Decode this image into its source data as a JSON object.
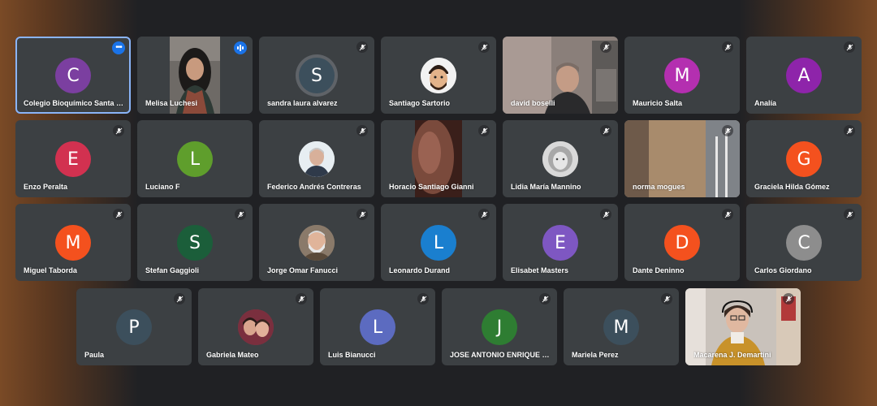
{
  "colors": {
    "tile_bg": "#3c4043",
    "active_outline": "#8ab4f8",
    "accent": "#1a73e8"
  },
  "icons": {
    "muted": "mic-off-icon",
    "speaking": "audio-bars-icon",
    "more": "more-options-icon"
  },
  "participants": [
    {
      "name": "Colegio Bioquímico Santa F...",
      "initial": "C",
      "color": "#7b3fa0"
    },
    {
      "name": "Melisa Luchesi"
    },
    {
      "name": "sandra laura alvarez",
      "initial": "S",
      "color": "#3c4f5c"
    },
    {
      "name": "Santiago Sartorio"
    },
    {
      "name": "david boselli"
    },
    {
      "name": "Mauricio Salta",
      "initial": "M",
      "color": "#b42fb0"
    },
    {
      "name": "Analía",
      "initial": "A",
      "color": "#8e24aa"
    },
    {
      "name": "Enzo Peralta",
      "initial": "E",
      "color": "#d23150"
    },
    {
      "name": "Luciano F",
      "initial": "L",
      "color": "#5f9e2c"
    },
    {
      "name": "Federico Andrés Contreras"
    },
    {
      "name": "Horacio Santiago Gianni"
    },
    {
      "name": "Lidia María Mannino"
    },
    {
      "name": "norma mogues"
    },
    {
      "name": "Graciela Hilda Gómez",
      "initial": "G",
      "color": "#f4511e"
    },
    {
      "name": "Miguel Taborda",
      "initial": "M",
      "color": "#f4511e"
    },
    {
      "name": "Stefan Gaggioli",
      "initial": "S",
      "color": "#1b5e3a"
    },
    {
      "name": "Jorge Omar Fanucci"
    },
    {
      "name": "Leonardo Durand",
      "initial": "L",
      "color": "#1a7fcf"
    },
    {
      "name": "Elisabet Masters",
      "initial": "E",
      "color": "#7e57c2"
    },
    {
      "name": "Dante Deninno",
      "initial": "D",
      "color": "#f4511e"
    },
    {
      "name": "Carlos Giordano",
      "initial": "C",
      "color": "#8d8d8d"
    },
    {
      "name": "Paula",
      "initial": "P",
      "color": "#3c4f5c"
    },
    {
      "name": "Gabriela Mateo"
    },
    {
      "name": "Luis Bianucci",
      "initial": "L",
      "color": "#5c6bc0"
    },
    {
      "name": "JOSE ANTONIO ENRIQUE B...",
      "initial": "J",
      "color": "#2e7d32"
    },
    {
      "name": "Mariela Perez",
      "initial": "M",
      "color": "#3c4f5c"
    },
    {
      "name": "Macarena J. Demartini"
    }
  ]
}
